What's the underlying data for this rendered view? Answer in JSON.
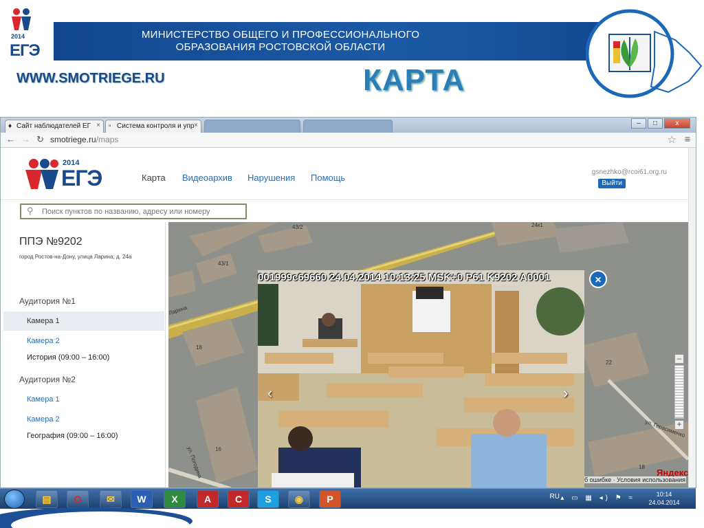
{
  "slide": {
    "logo_year": "2014",
    "logo_text": "ЕГЭ",
    "ministry_line1": "МИНИСТЕРСТВО ОБЩЕГО И ПРОФЕССИОНАЛЬНОГО",
    "ministry_line2": "ОБРАЗОВАНИЯ РОСТОВСКОЙ ОБЛАСТИ",
    "site_url": "WWW.SMOTRIEGE.RU",
    "title": "КАРТА"
  },
  "browser": {
    "tabs": [
      {
        "label": "Сайт наблюдателей ЕГ",
        "icon": "ege-favicon"
      },
      {
        "label": "Система контроля и упр",
        "icon": "page-icon"
      }
    ],
    "address_host": "smotriege.ru",
    "address_path": "/maps",
    "min_label": "–",
    "max_label": "□",
    "close_label": "x"
  },
  "site": {
    "logo_year": "2014",
    "logo_text": "ЕГЭ",
    "nav": [
      "Карта",
      "Видеоархив",
      "Нарушения",
      "Помощь"
    ],
    "user_email": "gsnezhko@rcoi61.org.ru",
    "logout_label": "Выйти",
    "search_placeholder": "Поиск пунктов по названию, адресу или номеру"
  },
  "sidebar": {
    "ppe_title": "ППЭ №9202",
    "ppe_address": "город Ростов-на-Дону, улица Ларина, д. 24а",
    "rooms": [
      {
        "name": "Аудитория №1",
        "cameras": [
          "Камера 1",
          "Камера 2"
        ],
        "schedule": "История (09:00 – 16:00)"
      },
      {
        "name": "Аудитория №2",
        "cameras": [
          "Камера 1",
          "Камера 2"
        ],
        "schedule": "География (09:00 – 16:00)"
      }
    ]
  },
  "map": {
    "labels": [
      "43/2",
      "24к1",
      "43/1",
      "18",
      "22",
      "16",
      "18",
      "ул. Герасименко",
      "ул. Погодина",
      "Ларина"
    ],
    "yandex_logo": "Яндекс",
    "terms": "б ошибке · Условия использования"
  },
  "video": {
    "osd": "001999c69660 24.04.2014 10:13:25 MSK+0 P61 K9202 A0001",
    "close_label": "×",
    "prev_label": "‹",
    "next_label": "›"
  },
  "taskbar": {
    "apps": [
      "explorer-icon",
      "opera-icon",
      "outlook-icon",
      "word-icon",
      "excel-icon",
      "acrobat-icon",
      "app-icon",
      "skype-icon",
      "chrome-icon",
      "powerpoint-icon"
    ],
    "lang": "RU",
    "time": "10:14",
    "date": "24.04.2014"
  },
  "colors": {
    "brand_blue": "#1a4a8a",
    "link_blue": "#2a6db5",
    "title_blue": "#2a7fb8"
  }
}
